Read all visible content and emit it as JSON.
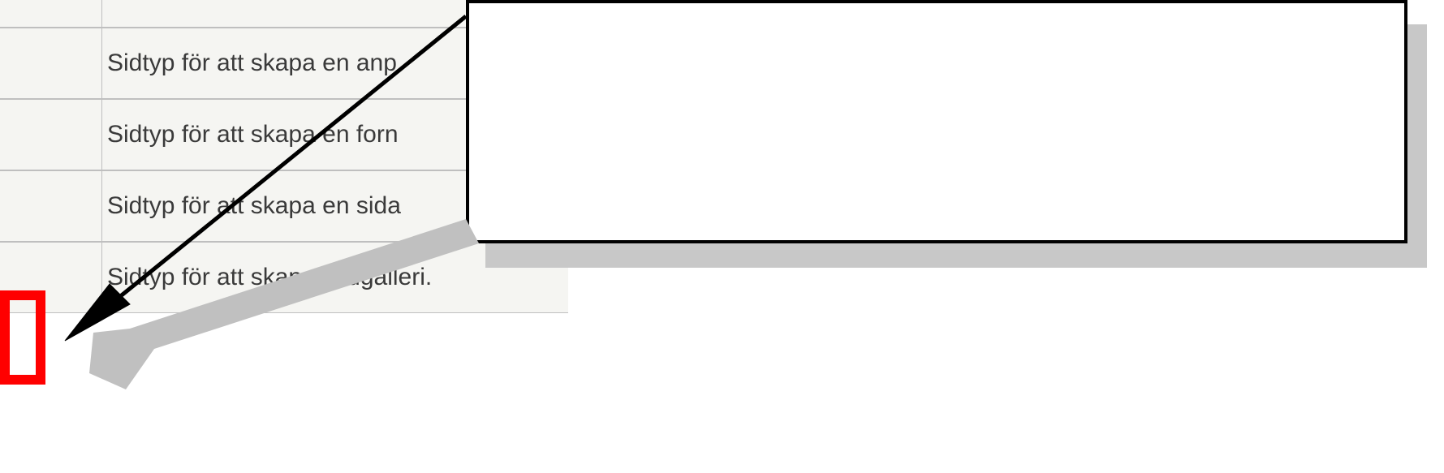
{
  "list": {
    "rows": [
      {
        "label": ""
      },
      {
        "label": "Sidtyp för att skapa en anp"
      },
      {
        "label": "Sidtyp för att skapa en forn"
      },
      {
        "label": "Sidtyp för att skapa en sida"
      },
      {
        "label": "Sidtyp för att skapa bildgalleri."
      }
    ]
  },
  "callout": {
    "text": ""
  }
}
